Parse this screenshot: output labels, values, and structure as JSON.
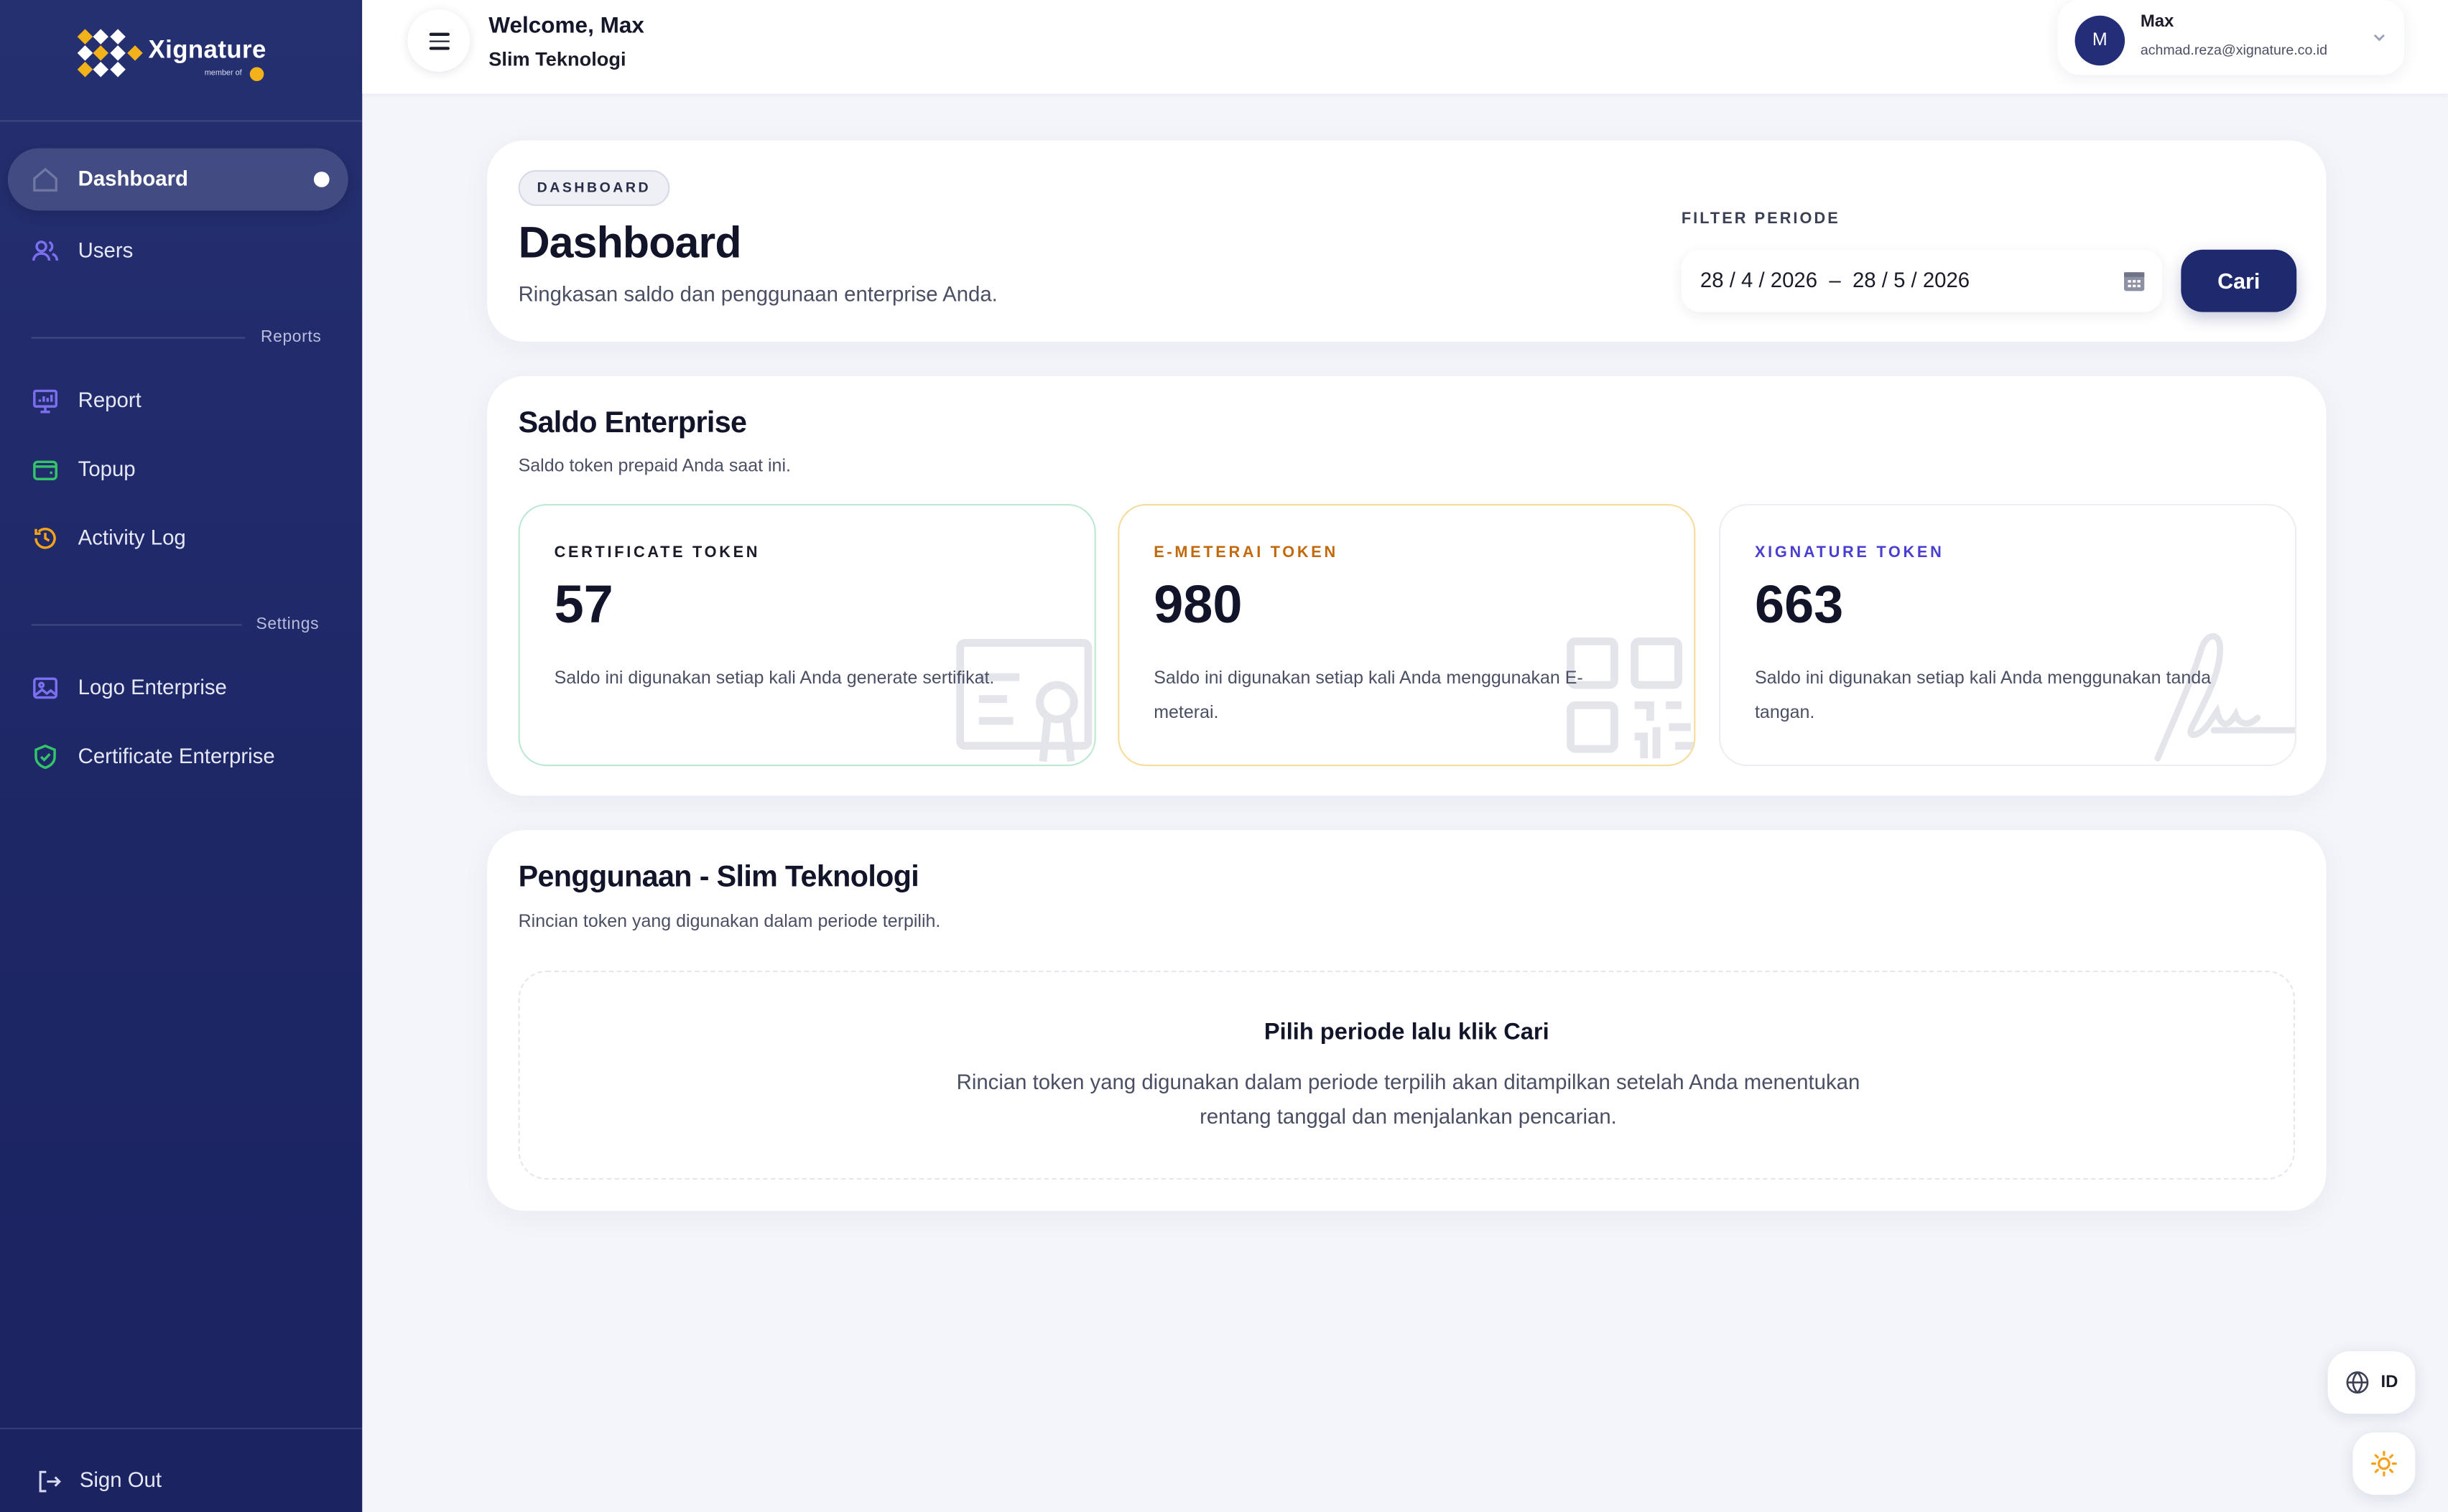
{
  "brand": {
    "name": "Xignature",
    "sub": "member of"
  },
  "colors": {
    "sidebar": "#1e2766",
    "primary": "#1f2a6e",
    "certificate": "#1a1d29",
    "emeterai": "#c2690c",
    "xignature": "#4a3fd1"
  },
  "sidebar": {
    "dashboard": {
      "label": "Dashboard",
      "icon": "home-icon"
    },
    "users": {
      "label": "Users",
      "icon": "users-icon"
    },
    "reports_section": "Reports",
    "report": {
      "label": "Report",
      "icon": "presentation-chart-icon"
    },
    "topup": {
      "label": "Topup",
      "icon": "wallet-icon"
    },
    "activity": {
      "label": "Activity Log",
      "icon": "history-icon"
    },
    "settings_section": "Settings",
    "logo": {
      "label": "Logo Enterprise",
      "icon": "image-icon"
    },
    "certificate": {
      "label": "Certificate Enterprise",
      "icon": "shield-check-icon"
    },
    "signout": {
      "label": "Sign Out",
      "icon": "sign-out-icon"
    }
  },
  "topbar": {
    "welcome": "Welcome, Max",
    "company": "Slim Teknologi",
    "user": {
      "initial": "M",
      "name": "Max",
      "email": "achmad.reza@xignature.co.id"
    }
  },
  "header": {
    "badge": "DASHBOARD",
    "title": "Dashboard",
    "subtitle": "Ringkasan saldo dan penggunaan enterprise Anda.",
    "filter_label": "FILTER PERIODE",
    "date_range": "28 / 4 / 2026  –  28 / 5 / 2026",
    "search_button": "Cari"
  },
  "saldo": {
    "title": "Saldo Enterprise",
    "subtitle": "Saldo token prepaid Anda saat ini.",
    "tokens": [
      {
        "label": "CERTIFICATE TOKEN",
        "value": "57",
        "desc": "Saldo ini digunakan setiap kali Anda generate sertifikat."
      },
      {
        "label": "E-METERAI TOKEN",
        "value": "980",
        "desc": "Saldo ini digunakan setiap kali Anda menggunakan E-meterai."
      },
      {
        "label": "XIGNATURE TOKEN",
        "value": "663",
        "desc": "Saldo ini digunakan setiap kali Anda menggunakan tanda tangan."
      }
    ]
  },
  "usage": {
    "title": "Penggunaan - Slim Teknologi",
    "subtitle": "Rincian token yang digunakan dalam periode terpilih.",
    "empty_title": "Pilih periode lalu klik Cari",
    "empty_desc": "Rincian token yang digunakan dalam periode terpilih akan ditampilkan setelah Anda menentukan rentang tanggal dan menjalankan pencarian."
  },
  "floating": {
    "language": "ID"
  }
}
